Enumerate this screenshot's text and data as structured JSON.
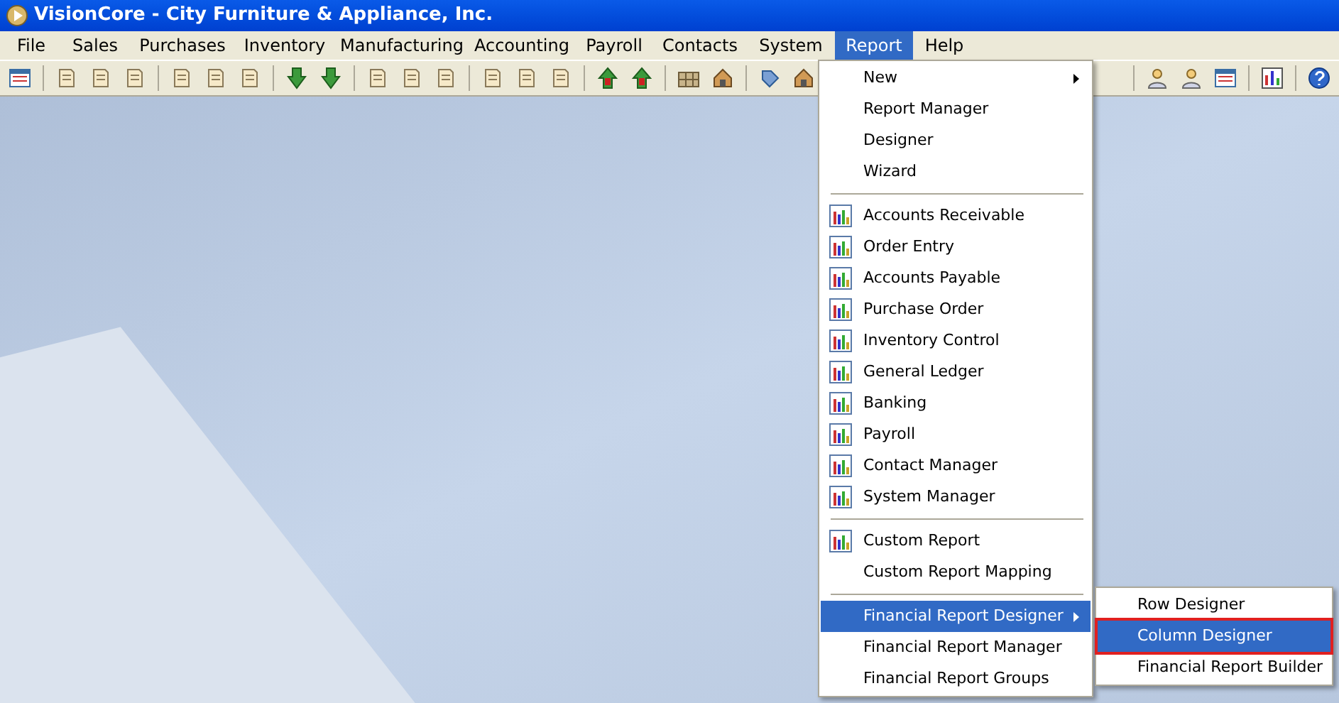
{
  "window": {
    "title": "VisionCore - City Furniture & Appliance, Inc."
  },
  "menu_bar": [
    {
      "label": "File",
      "selected": false
    },
    {
      "label": "Sales",
      "selected": false
    },
    {
      "label": "Purchases",
      "selected": false
    },
    {
      "label": "Inventory",
      "selected": false
    },
    {
      "label": "Manufacturing",
      "selected": false
    },
    {
      "label": "Accounting",
      "selected": false
    },
    {
      "label": "Payroll",
      "selected": false
    },
    {
      "label": "Contacts",
      "selected": false
    },
    {
      "label": "System",
      "selected": false
    },
    {
      "label": "Report",
      "selected": true
    },
    {
      "label": "Help",
      "selected": false
    }
  ],
  "report_menu": [
    {
      "kind": "command",
      "label": "New",
      "has_submenu": true,
      "icon": false,
      "selected": false
    },
    {
      "kind": "command",
      "label": "Report Manager",
      "has_submenu": false,
      "icon": false,
      "selected": false
    },
    {
      "kind": "command",
      "label": "Designer",
      "has_submenu": false,
      "icon": false,
      "selected": false
    },
    {
      "kind": "command",
      "label": "Wizard",
      "has_submenu": false,
      "icon": false,
      "selected": false
    },
    {
      "kind": "separator"
    },
    {
      "kind": "command",
      "label": "Accounts Receivable",
      "has_submenu": false,
      "icon": true,
      "selected": false
    },
    {
      "kind": "command",
      "label": "Order Entry",
      "has_submenu": false,
      "icon": true,
      "selected": false
    },
    {
      "kind": "command",
      "label": "Accounts Payable",
      "has_submenu": false,
      "icon": true,
      "selected": false
    },
    {
      "kind": "command",
      "label": "Purchase Order",
      "has_submenu": false,
      "icon": true,
      "selected": false
    },
    {
      "kind": "command",
      "label": "Inventory Control",
      "has_submenu": false,
      "icon": true,
      "selected": false
    },
    {
      "kind": "command",
      "label": "General Ledger",
      "has_submenu": false,
      "icon": true,
      "selected": false
    },
    {
      "kind": "command",
      "label": "Banking",
      "has_submenu": false,
      "icon": true,
      "selected": false
    },
    {
      "kind": "command",
      "label": "Payroll",
      "has_submenu": false,
      "icon": true,
      "selected": false
    },
    {
      "kind": "command",
      "label": "Contact Manager",
      "has_submenu": false,
      "icon": true,
      "selected": false
    },
    {
      "kind": "command",
      "label": "System Manager",
      "has_submenu": false,
      "icon": true,
      "selected": false
    },
    {
      "kind": "separator"
    },
    {
      "kind": "command",
      "label": "Custom Report",
      "has_submenu": false,
      "icon": true,
      "selected": false
    },
    {
      "kind": "command",
      "label": "Custom Report Mapping",
      "has_submenu": false,
      "icon": false,
      "selected": false
    },
    {
      "kind": "separator"
    },
    {
      "kind": "command",
      "label": "Financial Report Designer",
      "has_submenu": true,
      "icon": false,
      "selected": true
    },
    {
      "kind": "command",
      "label": "Financial Report Manager",
      "has_submenu": false,
      "icon": false,
      "selected": false
    },
    {
      "kind": "command",
      "label": "Financial Report Groups",
      "has_submenu": false,
      "icon": false,
      "selected": false
    }
  ],
  "financial_report_designer_submenu": [
    {
      "label": "Row Designer",
      "selected": false,
      "outlined": false
    },
    {
      "label": "Column Designer",
      "selected": true,
      "outlined": true
    },
    {
      "label": "Financial Report Builder",
      "selected": false,
      "outlined": false
    }
  ]
}
